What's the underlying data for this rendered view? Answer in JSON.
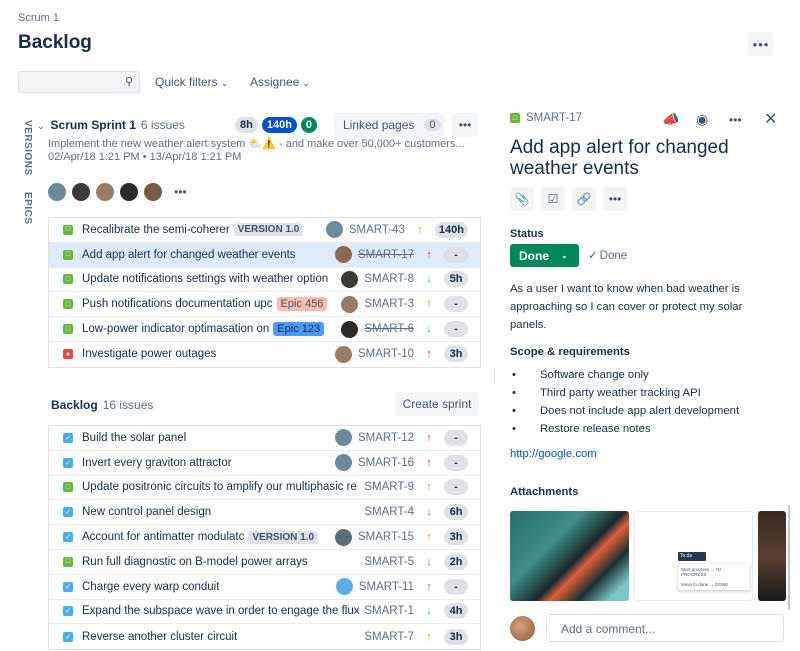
{
  "breadcrumb": "Scrum 1",
  "page_title": "Backlog",
  "page_more_icon": "ellipsis-icon",
  "search": {
    "value": "",
    "placeholder": "",
    "icon": "search-icon"
  },
  "filters": [
    {
      "label": "Quick filters",
      "icon": "chevron-down-icon"
    },
    {
      "label": "Assignee",
      "icon": "chevron-down-icon"
    }
  ],
  "side_tabs": [
    "VERSIONS",
    "EPICS"
  ],
  "sprint": {
    "name": "Scrum Sprint 1",
    "count": "6 issues",
    "pills": {
      "todo": "8h",
      "in_progress": "140h",
      "done": "0"
    },
    "linked_pages_label": "Linked pages",
    "linked_pages_count": "0",
    "goal": "Implement the new weather alert system ⛅⚠️ - and make over 50,000+ customers...",
    "dates": "02/Apr/18 1:21 PM • 13/Apr/18 1:21 PM",
    "avatar_colors": [
      "#6B8A9E",
      "#3E3A38",
      "#9C7B63",
      "#2E2A28",
      "#7A5A45"
    ],
    "avatars_more": "•••",
    "issues": [
      {
        "type": "story",
        "summary": "Recalibrate the semi-coherer",
        "tag": {
          "kind": "version",
          "label": "VERSION 1.0"
        },
        "avatar": "#6B8A9E",
        "key": "SMART-43",
        "key_done": false,
        "priority": "medium",
        "estimate": "140h",
        "selected": false
      },
      {
        "type": "story",
        "summary": "Add app alert for changed weather events",
        "tag": null,
        "avatar": "#8B6A50",
        "key": "SMART-17",
        "key_done": true,
        "priority": "high",
        "estimate": "-",
        "selected": true
      },
      {
        "type": "story",
        "summary": "Update notifications settings with weather option",
        "tag": null,
        "avatar": "#3E3A38",
        "key": "SMART-8",
        "key_done": false,
        "priority": "low",
        "estimate": "5h",
        "selected": false
      },
      {
        "type": "story",
        "summary": "Push notifications documentation upc",
        "tag": {
          "kind": "epic",
          "label": "Epic 456",
          "bg": "#FFBDAD",
          "fg": "#42526E"
        },
        "avatar": "#9C7B63",
        "key": "SMART-3",
        "key_done": false,
        "priority": "medium",
        "estimate": "-",
        "selected": false
      },
      {
        "type": "story",
        "summary": "Low-power indicator optimasation on",
        "tag": {
          "kind": "epic",
          "label": "Epic 123",
          "bg": "#4C9AFF",
          "fg": "#172B4D"
        },
        "avatar": "#2E2A28",
        "key": "SMART-6",
        "key_done": true,
        "priority": "low",
        "estimate": "-",
        "selected": false
      },
      {
        "type": "bug",
        "summary": "Investigate power outages",
        "tag": null,
        "avatar": "#9C7B63",
        "key": "SMART-10",
        "key_done": false,
        "priority": "high",
        "estimate": "3h",
        "selected": false
      }
    ]
  },
  "backlog": {
    "name": "Backlog",
    "count": "16 issues",
    "create_label": "Create sprint",
    "issues": [
      {
        "type": "task",
        "summary": "Build the solar panel",
        "tag": null,
        "avatar": "#6B8A9E",
        "key": "SMART-12",
        "key_done": false,
        "priority": "high",
        "estimate": "-"
      },
      {
        "type": "task",
        "summary": "Invert every graviton attractor",
        "tag": null,
        "avatar": "#6B8A9E",
        "key": "SMART-16",
        "key_done": false,
        "priority": "high",
        "estimate": "-"
      },
      {
        "type": "story",
        "summary": "Update positronic circuits to amplify our multiphasic re",
        "tag": null,
        "avatar": null,
        "key": "SMART-9",
        "key_done": false,
        "priority": "medium",
        "estimate": "-"
      },
      {
        "type": "task",
        "summary": "New control panel design",
        "tag": null,
        "avatar": null,
        "key": "SMART-4",
        "key_done": false,
        "priority": "low",
        "estimate": "6h"
      },
      {
        "type": "task",
        "summary": "Account for antimatter modulatc",
        "tag": {
          "kind": "version",
          "label": "VERSION 1.0"
        },
        "avatar": "#5A6E7A",
        "key": "SMART-15",
        "key_done": false,
        "priority": "medium",
        "estimate": "3h"
      },
      {
        "type": "story",
        "summary": "Run full diagnostic on B-model power arrays",
        "tag": null,
        "avatar": null,
        "key": "SMART-5",
        "key_done": false,
        "priority": "low",
        "estimate": "2h"
      },
      {
        "type": "task",
        "summary": "Charge every warp conduit",
        "tag": null,
        "avatar": "#5AAEE0",
        "key": "SMART-11",
        "key_done": false,
        "priority": "high",
        "estimate": "-"
      },
      {
        "type": "task",
        "summary": "Expand the subspace wave in order to engage the flux",
        "tag": null,
        "avatar": null,
        "key": "SMART-1",
        "key_done": false,
        "priority": "low",
        "estimate": "4h"
      },
      {
        "type": "task",
        "summary": "Reverse another cluster circuit",
        "tag": null,
        "avatar": null,
        "key": "SMART-7",
        "key_done": false,
        "priority": "medium",
        "estimate": "3h"
      }
    ]
  },
  "priority_colors": {
    "high": "#DE350B",
    "medium": "#FF8B00",
    "low": "#36B37E"
  },
  "detail": {
    "key": "SMART-17",
    "icons": [
      "megaphone-icon",
      "eye-icon",
      "ellipsis-icon",
      "close-icon"
    ],
    "title": "Add app alert for changed weather events",
    "tools": [
      "attachment-icon",
      "subtask-icon",
      "link-icon",
      "ellipsis-icon"
    ],
    "status_label": "Status",
    "status_value": "Done",
    "resolution": "Done",
    "description": "As a user I want to know when bad weather is approaching so I can cover or protect my solar panels.",
    "scope_heading": "Scope & requirements",
    "scope_items": [
      "Software change only",
      "Third party weather tracking API",
      "Does not include app alert development",
      "Restore release notes"
    ],
    "link": "http://google.com",
    "attachments_heading": "Attachments",
    "attachment_preview": {
      "button": "To do",
      "menu": [
        "Start progress → IN PROGRESS",
        "Move to done → DONE"
      ]
    },
    "comment_placeholder": "Add a comment..."
  }
}
